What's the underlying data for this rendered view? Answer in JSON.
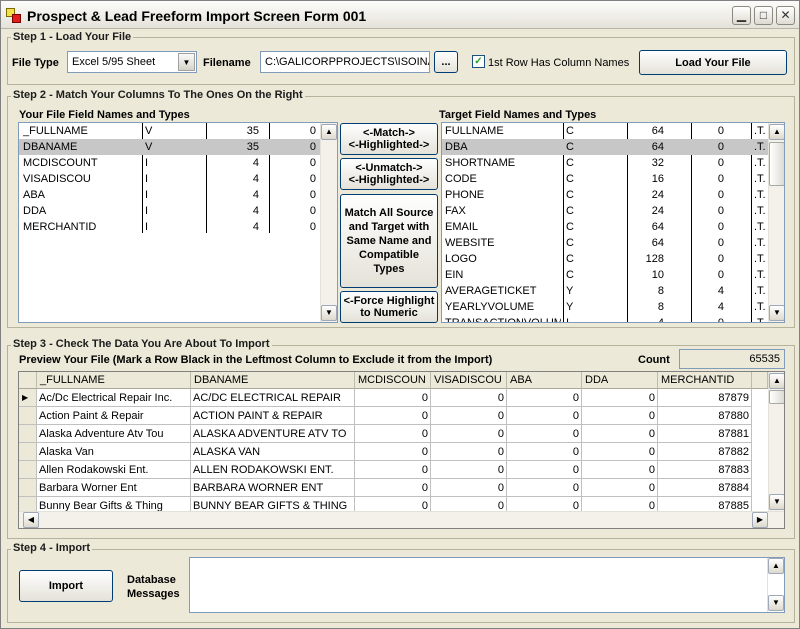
{
  "window": {
    "title": "Prospect & Lead Freeform Import Screen Form 001",
    "min_icon": "minimize-icon",
    "max_icon": "maximize-icon",
    "close_icon": "close-icon"
  },
  "step1": {
    "legend": "Step 1 - Load Your File",
    "file_type_label": "File Type",
    "file_type_value": "Excel 5/95 Sheet",
    "filename_label": "Filename",
    "filename_value": "C:\\GALICORPPROJECTS\\ISOINAB",
    "browse_label": "...",
    "first_row_label": "1st Row Has Column Names",
    "first_row_checked": "✓",
    "load_button": "Load Your File"
  },
  "step2": {
    "legend": "Step 2 - Match Your Columns To The Ones On the Right",
    "source_title": "Your File Field Names and Types",
    "target_title": "Target Field Names and Types",
    "source_fields": [
      {
        "name": "_FULLNAME",
        "type": "V",
        "size": "35",
        "dec": "0"
      },
      {
        "name": "DBANAME",
        "type": "V",
        "size": "35",
        "dec": "0"
      },
      {
        "name": "MCDISCOUNT",
        "type": "I",
        "size": "4",
        "dec": "0"
      },
      {
        "name": "VISADISCOU",
        "type": "I",
        "size": "4",
        "dec": "0"
      },
      {
        "name": "ABA",
        "type": "I",
        "size": "4",
        "dec": "0"
      },
      {
        "name": "DDA",
        "type": "I",
        "size": "4",
        "dec": "0"
      },
      {
        "name": "MERCHANTID",
        "type": "I",
        "size": "4",
        "dec": "0"
      }
    ],
    "target_fields": [
      {
        "name": "FULLNAME",
        "type": "C",
        "size": "64",
        "dec": "0",
        "flag": ".T."
      },
      {
        "name": "DBA",
        "type": "C",
        "size": "64",
        "dec": "0",
        "flag": ".T."
      },
      {
        "name": "SHORTNAME",
        "type": "C",
        "size": "32",
        "dec": "0",
        "flag": ".T."
      },
      {
        "name": "CODE",
        "type": "C",
        "size": "16",
        "dec": "0",
        "flag": ".T."
      },
      {
        "name": "PHONE",
        "type": "C",
        "size": "24",
        "dec": "0",
        "flag": ".T."
      },
      {
        "name": "FAX",
        "type": "C",
        "size": "24",
        "dec": "0",
        "flag": ".T."
      },
      {
        "name": "EMAIL",
        "type": "C",
        "size": "64",
        "dec": "0",
        "flag": ".T."
      },
      {
        "name": "WEBSITE",
        "type": "C",
        "size": "64",
        "dec": "0",
        "flag": ".T."
      },
      {
        "name": "LOGO",
        "type": "C",
        "size": "128",
        "dec": "0",
        "flag": ".T."
      },
      {
        "name": "EIN",
        "type": "C",
        "size": "10",
        "dec": "0",
        "flag": ".T."
      },
      {
        "name": "AVERAGETICKET",
        "type": "Y",
        "size": "8",
        "dec": "4",
        "flag": ".T."
      },
      {
        "name": "YEARLYVOLUME",
        "type": "Y",
        "size": "8",
        "dec": "4",
        "flag": ".T."
      },
      {
        "name": "TRANSACTIONVOLUME",
        "type": "I",
        "size": "4",
        "dec": "0",
        "flag": ".T."
      }
    ],
    "match_button_1": "<-Match->",
    "match_button_2": "<-Highlighted->",
    "unmatch_button_1": "<-Unmatch->",
    "unmatch_button_2": "<-Highlighted->",
    "match_all_1": "Match All Source",
    "match_all_2": "and Target with",
    "match_all_3": "Same Name and",
    "match_all_4": "Compatible",
    "match_all_5": "Types",
    "force_1": "<-Force Highlight",
    "force_2": "to Numeric"
  },
  "step3": {
    "legend": "Step 3 - Check The Data You Are About To Import",
    "preview_label": "Preview Your File (Mark a Row Black in the Leftmost Column to Exclude it from the Import)",
    "count_label": "Count",
    "count_value": "65535",
    "columns": [
      "_FULLNAME",
      "DBANAME",
      "MCDISCOUN",
      "VISADISCOU",
      "ABA",
      "DDA",
      "MERCHANTID"
    ],
    "rows": [
      [
        "Ac/Dc Electrical Repair Inc.",
        "AC/DC ELECTRICAL REPAIR",
        "0",
        "0",
        "0",
        "0",
        "87879"
      ],
      [
        "Action Paint & Repair",
        "ACTION PAINT & REPAIR",
        "0",
        "0",
        "0",
        "0",
        "87880"
      ],
      [
        "Alaska Adventure Atv Tou",
        "ALASKA ADVENTURE ATV TO",
        "0",
        "0",
        "0",
        "0",
        "87881"
      ],
      [
        "Alaska Van",
        "ALASKA VAN",
        "0",
        "0",
        "0",
        "0",
        "87882"
      ],
      [
        "Allen Rodakowski Ent.",
        "ALLEN RODAKOWSKI ENT.",
        "0",
        "0",
        "0",
        "0",
        "87883"
      ],
      [
        "Barbara Worner Ent",
        "BARBARA WORNER ENT",
        "0",
        "0",
        "0",
        "0",
        "87884"
      ],
      [
        "Bunny Bear Gifts & Thing",
        "BUNNY BEAR GIFTS & THING",
        "0",
        "0",
        "0",
        "0",
        "87885"
      ]
    ]
  },
  "step4": {
    "legend": "Step 4 - Import",
    "import_button": "Import",
    "db_label_1": "Database",
    "db_label_2": "Messages",
    "messages": ""
  }
}
